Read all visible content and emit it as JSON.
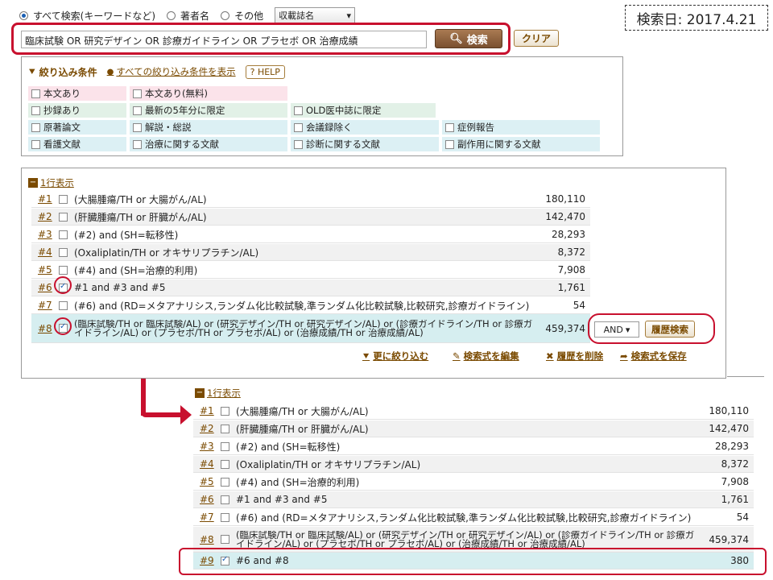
{
  "search": {
    "radio_options": [
      {
        "label": "すべて検索(キーワードなど)",
        "selected": true
      },
      {
        "label": "著者名",
        "selected": false
      },
      {
        "label": "その他",
        "selected": false
      }
    ],
    "journal_select": "収載誌名",
    "query": "臨床試験 OR 研究デザイン OR 診療ガイドライン OR プラセボ OR 治療成績",
    "search_button": "検索",
    "clear_button": "クリア"
  },
  "search_date": "検索日: 2017.4.21",
  "filters": {
    "title": "絞り込み条件",
    "all_link": "すべての絞り込み条件を表示",
    "help": "HELP",
    "rows": [
      [
        "本文あり",
        "本文あり(無料)"
      ],
      [
        "抄録あり",
        "最新の5年分に限定",
        "OLD医中誌に限定"
      ],
      [
        "原著論文",
        "解説・総説",
        "会議録除く",
        "症例報告"
      ],
      [
        "看護文献",
        "治療に関する文献",
        "診断に関する文献",
        "副作用に関する文献"
      ]
    ]
  },
  "history": {
    "toggle_label": "1行表示",
    "rows": [
      {
        "num": "#1",
        "query": "(大腸腫瘍/TH or 大腸がん/AL)",
        "count": "180,110",
        "checked": false
      },
      {
        "num": "#2",
        "query": "(肝臓腫瘍/TH or 肝臓がん/AL)",
        "count": "142,470",
        "checked": false
      },
      {
        "num": "#3",
        "query": "(#2) and (SH=転移性)",
        "count": "28,293",
        "checked": false
      },
      {
        "num": "#4",
        "query": "(Oxaliplatin/TH or オキサリプラチン/AL)",
        "count": "8,372",
        "checked": false
      },
      {
        "num": "#5",
        "query": "(#4) and (SH=治療的利用)",
        "count": "7,908",
        "checked": false
      },
      {
        "num": "#6",
        "query": "#1 and #3 and #5",
        "count": "1,761",
        "checked": true
      },
      {
        "num": "#7",
        "query": "(#6) and (RD=メタアナリシス,ランダム化比較試験,準ランダム化比較試験,比較研究,診療ガイドライン)",
        "count": "54",
        "checked": false
      },
      {
        "num": "#8",
        "query": "(臨床試験/TH or 臨床試験/AL) or (研究デザイン/TH or 研究デザイン/AL) or (診療ガイドライン/TH or 診療ガイドライン/AL) or (プラセボ/TH or プラセボ/AL) or (治療成績/TH or 治療成績/AL)",
        "count": "459,374",
        "checked": true
      }
    ],
    "and_select": "AND",
    "history_search_button": "履歴検索",
    "actions": [
      "更に絞り込む",
      "検索式を編集",
      "履歴を削除",
      "検索式を保存"
    ]
  },
  "history_after": {
    "toggle_label": "1行表示",
    "rows": [
      {
        "num": "#1",
        "query": "(大腸腫瘍/TH or 大腸がん/AL)",
        "count": "180,110",
        "checked": false
      },
      {
        "num": "#2",
        "query": "(肝臓腫瘍/TH or 肝臓がん/AL)",
        "count": "142,470",
        "checked": false
      },
      {
        "num": "#3",
        "query": "(#2) and (SH=転移性)",
        "count": "28,293",
        "checked": false
      },
      {
        "num": "#4",
        "query": "(Oxaliplatin/TH or オキサリプラチン/AL)",
        "count": "8,372",
        "checked": false
      },
      {
        "num": "#5",
        "query": "(#4) and (SH=治療的利用)",
        "count": "7,908",
        "checked": false
      },
      {
        "num": "#6",
        "query": "#1 and #3 and #5",
        "count": "1,761",
        "checked": false
      },
      {
        "num": "#7",
        "query": "(#6) and (RD=メタアナリシス,ランダム化比較試験,準ランダム化比較試験,比較研究,診療ガイドライン)",
        "count": "54",
        "checked": false
      },
      {
        "num": "#8",
        "query": "(臨床試験/TH or 臨床試験/AL) or (研究デザイン/TH or 研究デザイン/AL) or (診療ガイドライン/TH or 診療ガイドライン/AL) or (プラセボ/TH or プラセボ/AL) or (治療成績/TH or 治療成績/AL)",
        "count": "459,374",
        "checked": false
      },
      {
        "num": "#9",
        "query": "#6 and #8",
        "count": "380",
        "checked": true
      }
    ]
  }
}
